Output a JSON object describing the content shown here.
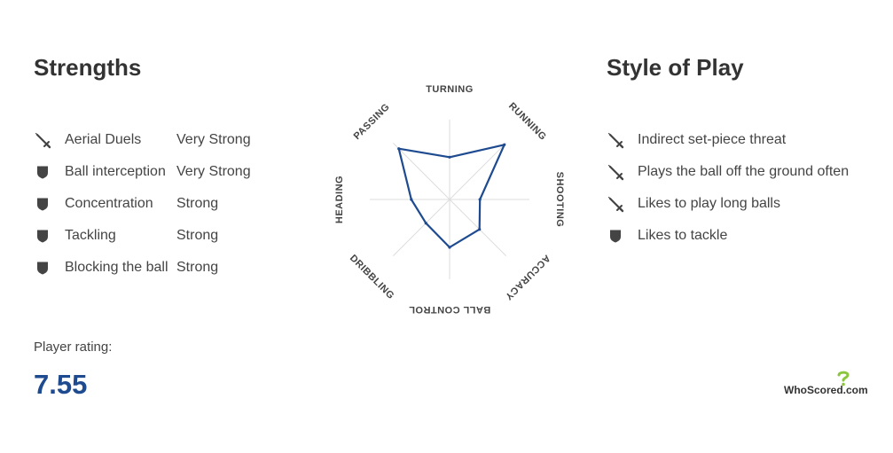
{
  "strengths": {
    "title": "Strengths",
    "items": [
      {
        "label": "Aerial Duels",
        "level": "Very Strong",
        "icon": "sword-icon"
      },
      {
        "label": "Ball interception",
        "level": "Very Strong",
        "icon": "shield-icon"
      },
      {
        "label": "Concentration",
        "level": "Strong",
        "icon": "shield-icon"
      },
      {
        "label": "Tackling",
        "level": "Strong",
        "icon": "shield-icon"
      },
      {
        "label": "Blocking the ball",
        "level": "Strong",
        "icon": "shield-icon"
      }
    ]
  },
  "style_of_play": {
    "title": "Style of Play",
    "items": [
      {
        "label": "Indirect set-piece threat",
        "icon": "sword-icon"
      },
      {
        "label": "Plays the ball off the ground often",
        "icon": "sword-icon"
      },
      {
        "label": "Likes to play long balls",
        "icon": "sword-icon"
      },
      {
        "label": "Likes to tackle",
        "icon": "shield-icon"
      }
    ]
  },
  "rating": {
    "label": "Player rating:",
    "value": "7.55"
  },
  "brand": {
    "name": "WhoScored",
    "suffix": ".com"
  },
  "colors": {
    "accent": "#1e4b8f",
    "text": "#333333",
    "icon": "#444444",
    "grid": "#dddddd",
    "brand_green": "#8cc63f"
  },
  "chart_data": {
    "type": "radar",
    "categories": [
      "TURNING",
      "RUNNING",
      "SHOOTING",
      "ACCURACY",
      "BALL CONTROL",
      "DRIBBLING",
      "HEADING",
      "PASSING"
    ],
    "values": [
      0.53,
      0.97,
      0.38,
      0.53,
      0.6,
      0.42,
      0.48,
      0.9
    ],
    "range": [
      0,
      1
    ],
    "grid": true
  }
}
